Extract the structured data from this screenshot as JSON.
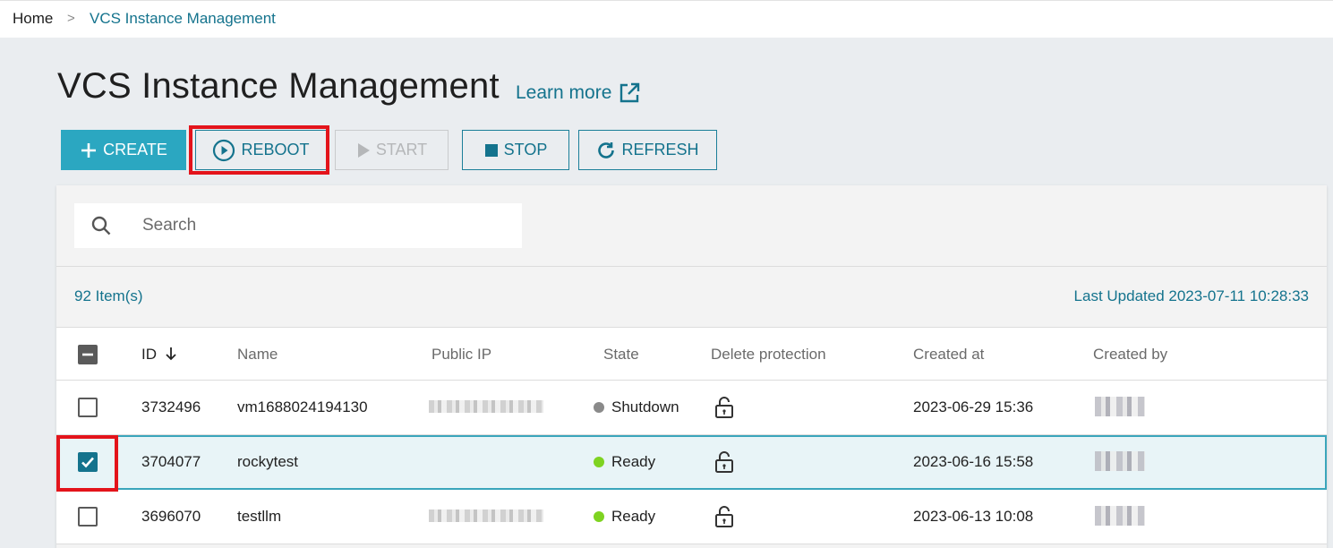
{
  "breadcrumb": {
    "home": "Home",
    "separator": ">",
    "current": "VCS Instance Management"
  },
  "page": {
    "title": "VCS Instance Management",
    "learn_more": "Learn more"
  },
  "toolbar": {
    "create": "CREATE",
    "reboot": "REBOOT",
    "start": "START",
    "stop": "STOP",
    "refresh": "REFRESH"
  },
  "search": {
    "placeholder": "Search"
  },
  "summary": {
    "item_count": "92 Item(s)",
    "last_updated": "Last Updated 2023-07-11 10:28:33"
  },
  "table": {
    "columns": [
      "ID",
      "Name",
      "Public IP",
      "State",
      "Delete protection",
      "Created at",
      "Created by"
    ],
    "rows": [
      {
        "id": "3732496",
        "name": "vm1688024194130",
        "public_ip": "",
        "state": "Shutdown",
        "created_at": "2023-06-29 15:36",
        "selected": false
      },
      {
        "id": "3704077",
        "name": "rockytest",
        "public_ip": "",
        "state": "Ready",
        "created_at": "2023-06-16 15:58",
        "selected": true
      },
      {
        "id": "3696070",
        "name": "testllm",
        "public_ip": "",
        "state": "Ready",
        "created_at": "2023-06-13 10:08",
        "selected": false
      }
    ]
  },
  "colors": {
    "accent": "#14738d",
    "primary_button": "#2ba7c1",
    "highlight": "#e3141b",
    "ready": "#7ed321",
    "shutdown": "#8a8a8a"
  }
}
